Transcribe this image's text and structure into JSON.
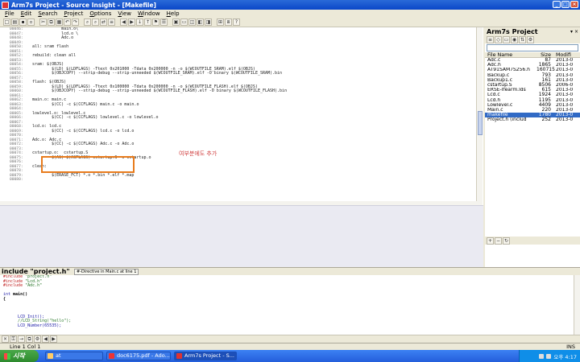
{
  "window": {
    "title": "Arm7s Project - Source Insight - [Makefile]"
  },
  "menu": [
    {
      "label": "File",
      "u": "F",
      "rest": "ile"
    },
    {
      "label": "Edit",
      "u": "E",
      "rest": "dit"
    },
    {
      "label": "Search",
      "u": "S",
      "rest": "earch"
    },
    {
      "label": "Project",
      "u": "P",
      "rest": "roject"
    },
    {
      "label": "Options",
      "u": "O",
      "rest": "ptions"
    },
    {
      "label": "View",
      "u": "V",
      "rest": "iew"
    },
    {
      "label": "Window",
      "u": "W",
      "rest": "indow"
    },
    {
      "label": "Help",
      "u": "H",
      "rest": "elp"
    }
  ],
  "editor": {
    "lines": [
      {
        "n": "00046:",
        "t": "            main.o\\"
      },
      {
        "n": "00047:",
        "t": "            lcd.o \\"
      },
      {
        "n": "00048:",
        "t": "            Adc.o"
      },
      {
        "n": "00049:",
        "t": ""
      },
      {
        "n": "00050:",
        "t": "all: sram flash"
      },
      {
        "n": "00051:",
        "t": ""
      },
      {
        "n": "00052:",
        "t": "rebuild: clean all"
      },
      {
        "n": "00053:",
        "t": ""
      },
      {
        "n": "00054:",
        "t": "sram: $(OBJS)"
      },
      {
        "n": "00055:",
        "t": "        $(LD) $(LDFLAGS) -Ttext 0x201000 -Tdata 0x200000 -n -o $(WCOUTFILE_SRAM).elf $(OBJS)"
      },
      {
        "n": "00056:",
        "t": "        $(OBJCOPY) --strip-debug --strip-unneeded $(WCOUTFILE_SRAM).elf -O binary $(WCOUTFILE_SRAM).bin"
      },
      {
        "n": "00057:",
        "t": ""
      },
      {
        "n": "00058:",
        "t": "flash: $(OBJS)"
      },
      {
        "n": "00059:",
        "t": "        $(LD) $(LDFLAGS) -Ttext 0x100000 -Tdata 0x200000 -n -o $(WCOUTFILE_FLASH).elf $(OBJS)"
      },
      {
        "n": "00060:",
        "t": "        $(OBJCOPY) --strip-debug --strip-unneeded $(WCOUTFILE_FLASH).elf -O binary $(WCOUTFILE_FLASH).bin"
      },
      {
        "n": "00061:",
        "t": ""
      },
      {
        "n": "00062:",
        "t": "main.o: main.c"
      },
      {
        "n": "00063:",
        "t": "        $(CC) -c $(CCFLAGS) main.c -o main.o"
      },
      {
        "n": "00064:",
        "t": ""
      },
      {
        "n": "00065:",
        "t": "lowlevel.o: lowlevel.c"
      },
      {
        "n": "00066:",
        "t": "        $(CC) -c $(CCFLAGS) lowlevel.c -o lowlevel.o"
      },
      {
        "n": "00067:",
        "t": ""
      },
      {
        "n": "00068:",
        "t": "lcd.o: lcd.c"
      },
      {
        "n": "00069:",
        "t": "        $(CC) -c $(CCFLAGS) lcd.c -o lcd.o"
      },
      {
        "n": "00070:",
        "t": ""
      },
      {
        "n": "00071:",
        "t": "Adc.o: Adc.c"
      },
      {
        "n": "00072:",
        "t": "        $(CC) -c $(CCFLAGS) Adc.c -o Adc.o"
      },
      {
        "n": "00073:",
        "t": ""
      },
      {
        "n": "00074:",
        "t": "cstartup.o:  cstartup.S"
      },
      {
        "n": "00075:",
        "t": "        $(AS) $(ASFLAGS) cstartup.S -o cstartup.o"
      },
      {
        "n": "00076:",
        "t": ""
      },
      {
        "n": "00077:",
        "t": "clean:"
      },
      {
        "n": "00078:",
        "t": ""
      },
      {
        "n": "00079:",
        "t": "        $(ERASE_FCT) *.o *.bin *.elf *.map"
      },
      {
        "n": "00080:",
        "t": ""
      }
    ],
    "annotation": "여부분에도 추가"
  },
  "symbol_window": {
    "title": "Arm7s Project",
    "columns": {
      "name": "File Name",
      "size": "Size",
      "modified": "Modifi"
    },
    "files": [
      {
        "name": "Adc.c",
        "size": "87",
        "modified": "2013-0"
      },
      {
        "name": "Adc.h",
        "size": "1865",
        "modified": "2013-0"
      },
      {
        "name": "AT91SAM7S256.h",
        "size": "160715",
        "modified": "2013-0"
      },
      {
        "name": "Backup.c",
        "size": "793",
        "modified": "2013-0"
      },
      {
        "name": "Backup1.c",
        "size": "161",
        "modified": "2013-0"
      },
      {
        "name": "cstartup.S",
        "size": "8506",
        "modified": "2006-0"
      },
      {
        "name": "ERSE-Ifearm.lds",
        "size": "615",
        "modified": "2013-0"
      },
      {
        "name": "Lcd.c",
        "size": "1924",
        "modified": "2013-0"
      },
      {
        "name": "Lcd.h",
        "size": "1195",
        "modified": "2013-0"
      },
      {
        "name": "Lowlevel.c",
        "size": "4409",
        "modified": "2013-0"
      },
      {
        "name": "Main.c",
        "size": "220",
        "modified": "2013-0"
      },
      {
        "name": "makefile",
        "size": "1780",
        "modified": "2013-0",
        "selected": true
      },
      {
        "name": "Project.h (includ",
        "size": "252",
        "modified": "2013-0"
      }
    ]
  },
  "context": {
    "symbol": "include \"project.h\"",
    "tag": "#-Directive in Main.c at line 1",
    "lines": [
      {
        "kw": "#include",
        "arg": " \"project.h\""
      },
      {
        "kw": "#include",
        "arg": " \"Lcd.h\""
      },
      {
        "kw": "#include",
        "arg": " \"Adc.h\""
      },
      {
        "kw": "",
        "arg": ""
      },
      {
        "kw": "int",
        "arg": " main()"
      },
      {
        "kw": "",
        "arg": "{"
      },
      {
        "kw": "",
        "arg": ""
      },
      {
        "kw": "",
        "arg": ""
      },
      {
        "kw": "",
        "arg": ""
      },
      {
        "kw": "",
        "arg": "      LCD_Init();"
      },
      {
        "kw": "",
        "arg": "      //LCD_String(\"hello\");"
      },
      {
        "kw": "",
        "arg": "      LCD_Number(65535);"
      }
    ]
  },
  "status": {
    "position": "Line 1  Col 1",
    "mode": "INS"
  },
  "taskbar": {
    "start": "시작",
    "tasks": [
      "at",
      "doc6175.pdf - Ado...",
      "Arm7s Project - S..."
    ],
    "clock": "오후 4:17"
  },
  "colors": {
    "accent": "#e87b1c",
    "selection": "#316ac5",
    "titlebar": "#0a46c8"
  }
}
